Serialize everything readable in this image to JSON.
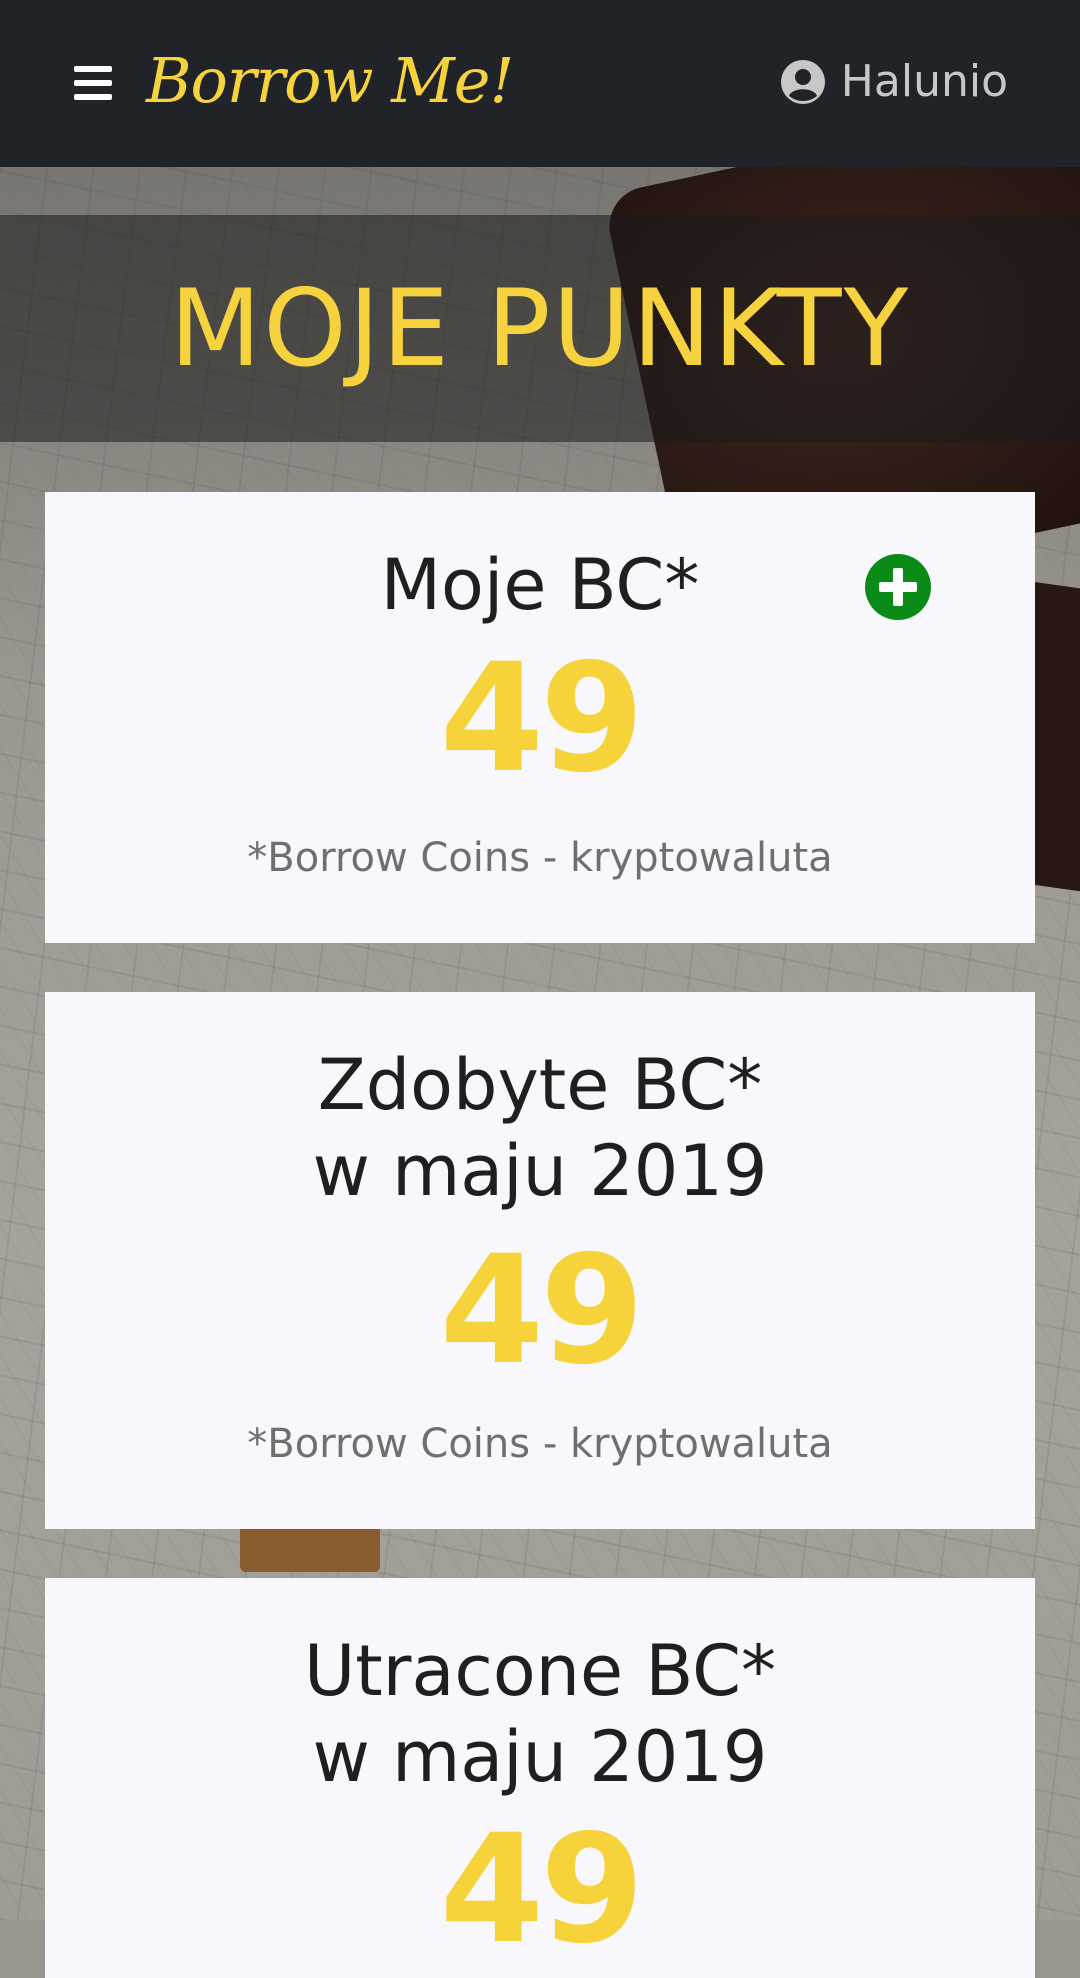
{
  "header": {
    "brand": "Borrow Me!",
    "username": "Halunio",
    "menu_icon": "hamburger-menu-icon",
    "user_icon": "user-circle-icon"
  },
  "hero": {
    "title": "MOJE PUNKTY"
  },
  "cards": [
    {
      "title_lines": [
        "Moje BC*"
      ],
      "value": "49",
      "note": "*Borrow Coins - kryptowaluta",
      "action_icon": "plus-circle-icon"
    },
    {
      "title_lines": [
        "Zdobyte BC*",
        "w maju 2019"
      ],
      "value": "49",
      "note": "*Borrow Coins - kryptowaluta"
    },
    {
      "title_lines": [
        "Utracone BC*",
        "w maju 2019"
      ],
      "value": "49"
    }
  ],
  "colors": {
    "accent": "#f6d33e",
    "header_bg": "#202327",
    "add_button": "#0a8a16",
    "card_bg": "#f8f8fc"
  }
}
